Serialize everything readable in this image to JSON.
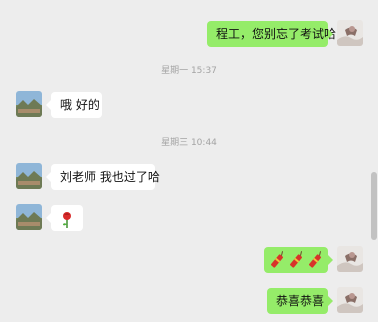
{
  "conversation": {
    "msg1": {
      "text": "程工，您别忘了考试哈"
    },
    "ts1": "星期一 15:37",
    "msg2": {
      "text": "哦 好的"
    },
    "ts2": "星期三 10:44",
    "msg3": {
      "text": "刘老师 我也过了哈"
    },
    "msg4": {
      "emoji": "rose"
    },
    "msg5": {
      "emoji": "firecracker x3"
    },
    "msg6": {
      "text": "恭喜恭喜"
    }
  },
  "colors": {
    "background": "#ededed",
    "outgoing_bubble": "#95ec69",
    "incoming_bubble": "#ffffff",
    "timestamp": "#a3a3a3"
  }
}
